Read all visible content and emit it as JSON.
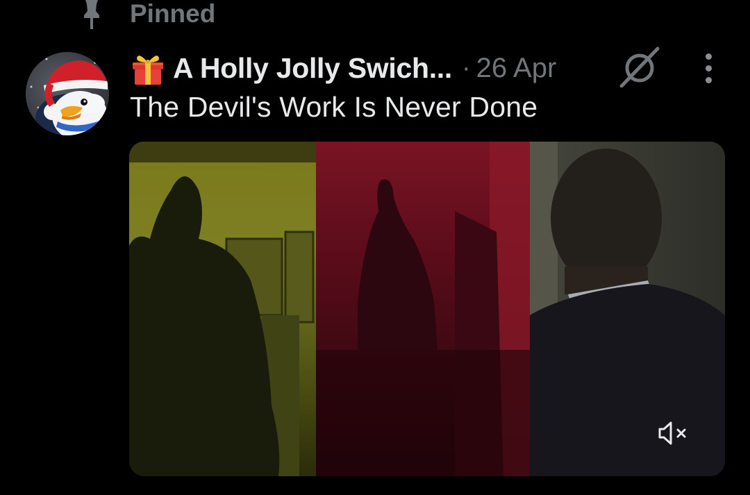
{
  "pinned": {
    "label": "Pinned",
    "icon": "pin-icon"
  },
  "post": {
    "display_name": "A Holly Jolly Swich...",
    "name_prefix_icon": "gift-icon",
    "separator": "·",
    "date": "26 Apr",
    "text": "The Devil's Work Is Never Done",
    "header_icons": [
      "grok-icon",
      "more-icon"
    ],
    "avatar_icon": "santa-penguin-avatar"
  },
  "media": {
    "type": "video",
    "panels": [
      "yellow-green",
      "red",
      "grey"
    ],
    "controls": [
      "mute-icon"
    ]
  },
  "colors": {
    "background": "#000000",
    "primary_text": "#e7e9ea",
    "secondary_text": "#71767b"
  }
}
